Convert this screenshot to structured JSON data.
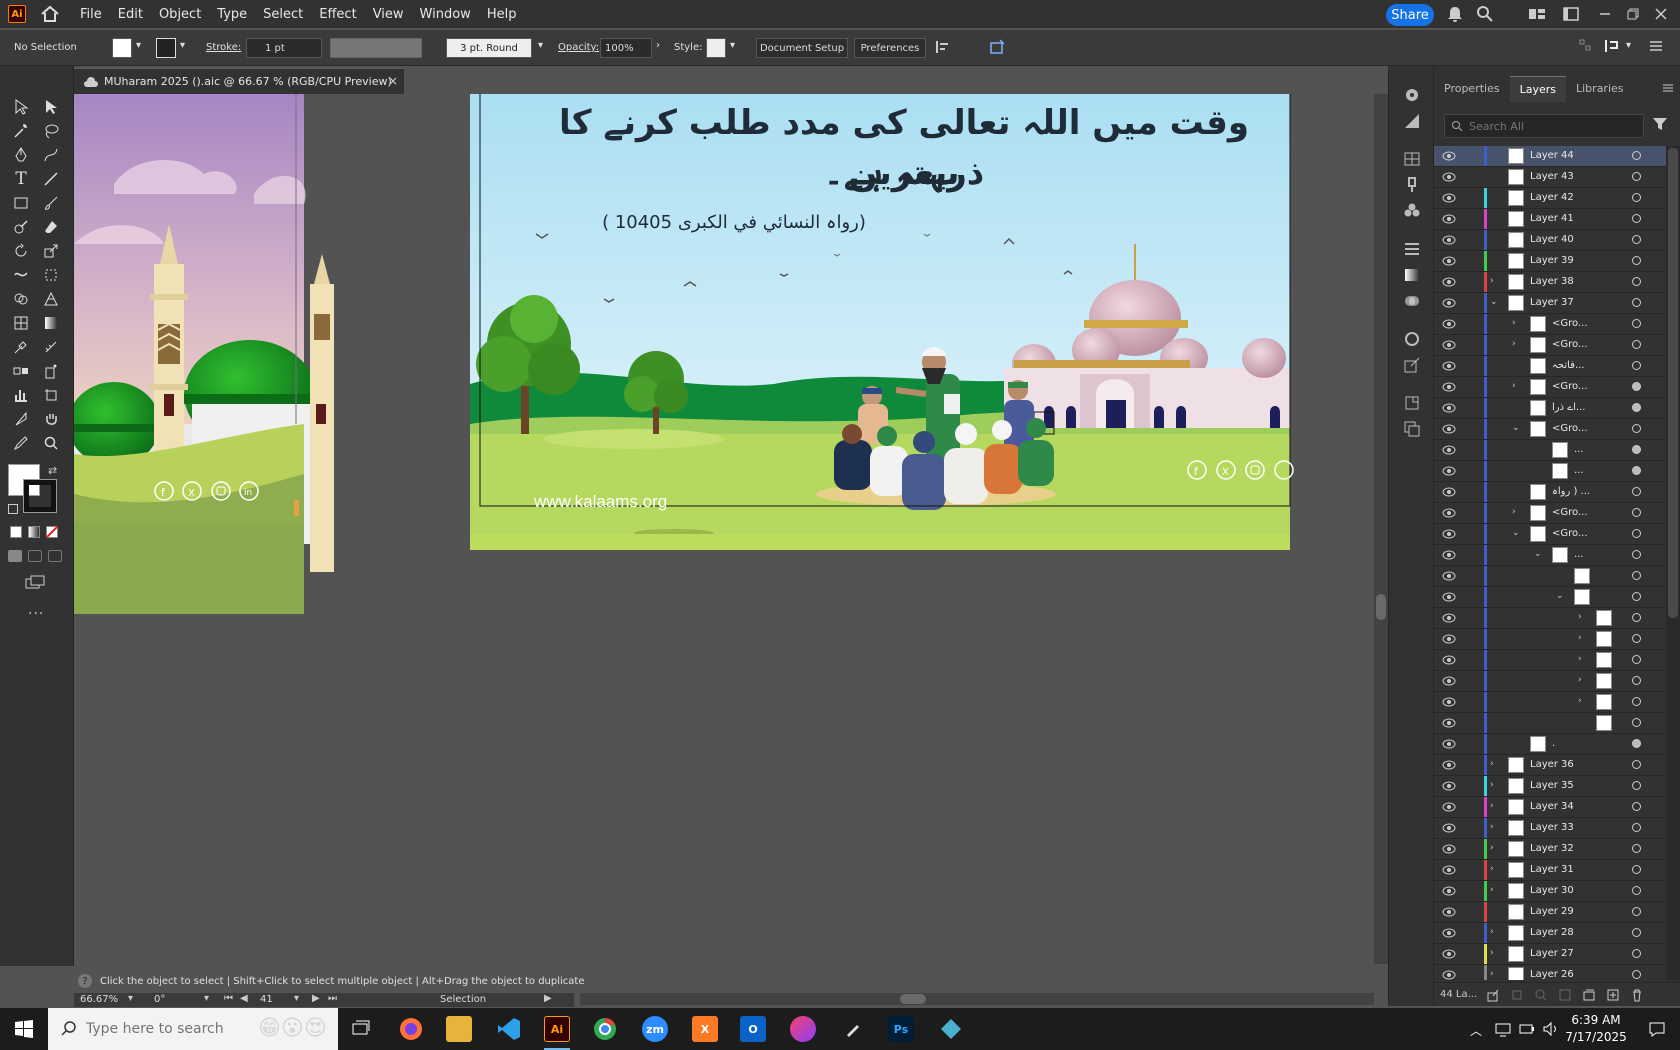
{
  "app": {
    "logo": "Ai",
    "menu": [
      "File",
      "Edit",
      "Object",
      "Type",
      "Select",
      "Effect",
      "View",
      "Window",
      "Help"
    ],
    "share_label": "Share"
  },
  "control": {
    "selection": "No Selection",
    "stroke_label": "Stroke:",
    "stroke_value": "1 pt",
    "brush": "3 pt. Round",
    "opacity_label": "Opacity:",
    "opacity_value": "100%",
    "style_label": "Style:",
    "document_setup": "Document Setup",
    "preferences": "Preferences"
  },
  "document": {
    "tab_title": "MUharam 2025 ().aic @ 66.67 % (RGB/CPU Preview)",
    "close": "×"
  },
  "artwork": {
    "heading_line1": "وقت میں اللہ تعالی کی مدد طلب کرنے کا بہترین",
    "heading_line2": "ذریعہ ہے۔",
    "reference": "(رواہ النسائي في الكبرى 10405 )",
    "website": "www.kalaams.org"
  },
  "status": {
    "hint": "Click the object to select  |  Shift+Click to select multiple object  |  Alt+Drag the object to duplicate",
    "zoom": "66.67%",
    "rotation": "0°",
    "artboard": "41",
    "tool": "Selection"
  },
  "panel": {
    "tabs": [
      "Properties",
      "Layers",
      "Libraries"
    ],
    "search_placeholder": "Search All",
    "footer_count": "44 La...",
    "layers": [
      {
        "name": "Layer 44",
        "color": "#3b5fcf",
        "indent": 0,
        "chev": "",
        "sel": true,
        "filled": false
      },
      {
        "name": "Layer 43",
        "color": "#333333",
        "indent": 0,
        "chev": "",
        "sel": false,
        "filled": false
      },
      {
        "name": "Layer 42",
        "color": "#3fd0e0",
        "indent": 0,
        "chev": "",
        "sel": false,
        "filled": false
      },
      {
        "name": "Layer 41",
        "color": "#e040c8",
        "indent": 0,
        "chev": "",
        "sel": false,
        "filled": false
      },
      {
        "name": "Layer 40",
        "color": "#3b5fcf",
        "indent": 0,
        "chev": "",
        "sel": false,
        "filled": false
      },
      {
        "name": "Layer 39",
        "color": "#3fd04a",
        "indent": 0,
        "chev": "",
        "sel": false,
        "filled": false
      },
      {
        "name": "Layer 38",
        "color": "#e04040",
        "indent": 0,
        "chev": ">",
        "sel": false,
        "filled": false
      },
      {
        "name": "Layer 37",
        "color": "#3b5fcf",
        "indent": 0,
        "chev": "v",
        "sel": false,
        "filled": false
      },
      {
        "name": "<Gro...",
        "color": "#3b5fcf",
        "indent": 1,
        "chev": ">",
        "sel": false,
        "filled": false
      },
      {
        "name": "<Gro...",
        "color": "#3b5fcf",
        "indent": 1,
        "chev": ">",
        "sel": false,
        "filled": false
      },
      {
        "name": "فاتحہ...",
        "color": "#3b5fcf",
        "indent": 1,
        "chev": "",
        "sel": false,
        "filled": false
      },
      {
        "name": "<Gro...",
        "color": "#3b5fcf",
        "indent": 1,
        "chev": ">",
        "sel": false,
        "filled": true
      },
      {
        "name": "اے ذرا...",
        "color": "#3b5fcf",
        "indent": 1,
        "chev": "",
        "sel": false,
        "filled": true
      },
      {
        "name": "<Gro...",
        "color": "#3b5fcf",
        "indent": 1,
        "chev": "v",
        "sel": false,
        "filled": false
      },
      {
        "name": "...",
        "color": "#3b5fcf",
        "indent": 2,
        "chev": "",
        "sel": false,
        "filled": true
      },
      {
        "name": "...",
        "color": "#3b5fcf",
        "indent": 2,
        "chev": "",
        "sel": false,
        "filled": true
      },
      {
        "name": "رواہ ) ...",
        "color": "#3b5fcf",
        "indent": 1,
        "chev": "",
        "sel": false,
        "filled": false
      },
      {
        "name": "<Gro...",
        "color": "#3b5fcf",
        "indent": 1,
        "chev": ">",
        "sel": false,
        "filled": false
      },
      {
        "name": "<Gro...",
        "color": "#3b5fcf",
        "indent": 1,
        "chev": "v",
        "sel": false,
        "filled": false
      },
      {
        "name": "...",
        "color": "#3b5fcf",
        "indent": 2,
        "chev": "v",
        "sel": false,
        "filled": false
      },
      {
        "name": "",
        "color": "#3b5fcf",
        "indent": 3,
        "chev": "",
        "sel": false,
        "filled": false
      },
      {
        "name": "",
        "color": "#3b5fcf",
        "indent": 3,
        "chev": "v",
        "sel": false,
        "filled": false
      },
      {
        "name": "",
        "color": "#3b5fcf",
        "indent": 4,
        "chev": ">",
        "sel": false,
        "filled": false
      },
      {
        "name": "",
        "color": "#3b5fcf",
        "indent": 4,
        "chev": ">",
        "sel": false,
        "filled": false
      },
      {
        "name": "",
        "color": "#3b5fcf",
        "indent": 4,
        "chev": ">",
        "sel": false,
        "filled": false
      },
      {
        "name": "",
        "color": "#3b5fcf",
        "indent": 4,
        "chev": ">",
        "sel": false,
        "filled": false
      },
      {
        "name": "",
        "color": "#3b5fcf",
        "indent": 4,
        "chev": ">",
        "sel": false,
        "filled": false
      },
      {
        "name": "",
        "color": "#3b5fcf",
        "indent": 4,
        "chev": "",
        "sel": false,
        "filled": false
      },
      {
        "name": ".",
        "color": "#3b5fcf",
        "indent": 1,
        "chev": "",
        "sel": false,
        "filled": true
      },
      {
        "name": "Layer 36",
        "color": "#3b5fcf",
        "indent": 0,
        "chev": ">",
        "sel": false,
        "filled": false
      },
      {
        "name": "Layer 35",
        "color": "#3fd0e0",
        "indent": 0,
        "chev": ">",
        "sel": false,
        "filled": false
      },
      {
        "name": "Layer 34",
        "color": "#e040c8",
        "indent": 0,
        "chev": ">",
        "sel": false,
        "filled": false
      },
      {
        "name": "Layer 33",
        "color": "#3b5fcf",
        "indent": 0,
        "chev": ">",
        "sel": false,
        "filled": false
      },
      {
        "name": "Layer 32",
        "color": "#3fd04a",
        "indent": 0,
        "chev": ">",
        "sel": false,
        "filled": false
      },
      {
        "name": "Layer 31",
        "color": "#e04040",
        "indent": 0,
        "chev": ">",
        "sel": false,
        "filled": false
      },
      {
        "name": "Layer 30",
        "color": "#3fd04a",
        "indent": 0,
        "chev": ">",
        "sel": false,
        "filled": false
      },
      {
        "name": "Layer 29",
        "color": "#e04040",
        "indent": 0,
        "chev": "",
        "sel": false,
        "filled": false
      },
      {
        "name": "Layer 28",
        "color": "#3b5fcf",
        "indent": 0,
        "chev": ">",
        "sel": false,
        "filled": false
      },
      {
        "name": "Layer 27",
        "color": "#e0e040",
        "indent": 0,
        "chev": ">",
        "sel": false,
        "filled": false
      },
      {
        "name": "Layer 26",
        "color": "#888888",
        "indent": 0,
        "chev": ">",
        "sel": false,
        "filled": false
      }
    ]
  },
  "taskbar": {
    "search_placeholder": "Type here to search",
    "time": "6:39 AM",
    "date": "7/17/2025",
    "apps": [
      "file-explorer",
      "firefox",
      "folder",
      "vscode",
      "illustrator",
      "chrome",
      "zoom",
      "xampp",
      "outlook",
      "creative-cloud",
      "pen-tool",
      "photoshop",
      "app"
    ]
  }
}
